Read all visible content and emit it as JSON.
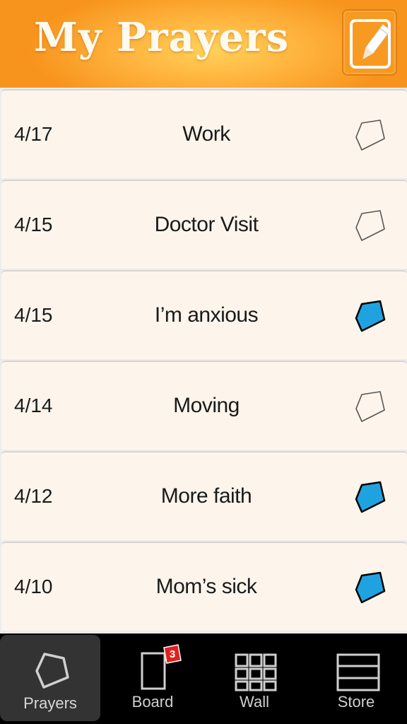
{
  "header": {
    "title": "My Prayers"
  },
  "prayers": [
    {
      "date": "4/17",
      "title": "Work",
      "checked": false
    },
    {
      "date": "4/15",
      "title": "Doctor Visit",
      "checked": false
    },
    {
      "date": "4/15",
      "title": "I’m anxious",
      "checked": true
    },
    {
      "date": "4/14",
      "title": "Moving",
      "checked": false
    },
    {
      "date": "4/12",
      "title": "More faith",
      "checked": true
    },
    {
      "date": "4/10",
      "title": "Mom’s sick",
      "checked": true
    }
  ],
  "tabbar": {
    "tabs": [
      {
        "label": "Prayers",
        "icon": "prayer-card-icon",
        "active": true
      },
      {
        "label": "Board",
        "icon": "board-icon",
        "active": false,
        "badge": "3"
      },
      {
        "label": "Wall",
        "icon": "grid-icon",
        "active": false
      },
      {
        "label": "Store",
        "icon": "store-icon",
        "active": false
      }
    ]
  },
  "colors": {
    "header_orange": "#f7941d",
    "row_background": "#fdf5ec",
    "check_fill": "#1fa3e0",
    "badge_red": "#e02020"
  }
}
